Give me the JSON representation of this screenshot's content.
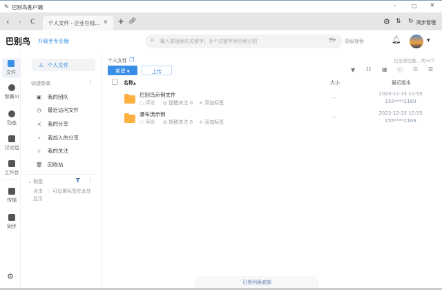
{
  "window": {
    "title": "巴别鸟客户端",
    "min": "–",
    "max": "□",
    "close": "×"
  },
  "tabbar": {
    "tab_title": "个人文件 - 企业在线...",
    "tab_close": "×",
    "new_tab": "+",
    "sync_label": "同步管理"
  },
  "header": {
    "logo": "巴别鸟",
    "upgrade": "升级至专业版",
    "search_placeholder": "输入要搜索的关键字，多个关键字用空格分割",
    "advanced_search": "高级搜索"
  },
  "rail": [
    {
      "label": "文件"
    },
    {
      "label": "智翼AI"
    },
    {
      "label": "动态"
    },
    {
      "label": "讨论组"
    },
    {
      "label": "工作台"
    },
    {
      "label": "传输"
    },
    {
      "label": "同步"
    }
  ],
  "sidebar": {
    "personal_files": "个人文件",
    "quick_menu": "快捷菜单",
    "items": [
      {
        "label": "我的团队"
      },
      {
        "label": "最近访问文件"
      },
      {
        "label": "我的分享"
      },
      {
        "label": "我加入的分享"
      },
      {
        "label": "我的关注"
      },
      {
        "label": "回收站"
      }
    ],
    "tags_title": "标签",
    "tags_hint_a": "点击",
    "tags_hint_b": "可设置标签在此处",
    "tags_hint_c": "显示"
  },
  "content": {
    "breadcrumb": "个人文件",
    "loaded_status": "已全部加载，共54个",
    "new_button": "新建",
    "upload_button": "上传",
    "col_name": "名称",
    "col_size": "大小",
    "col_version": "最近版本",
    "rows": [
      {
        "name": "巴别鸟示例文件",
        "comment": "评论",
        "remind": "提醒关注 0",
        "add_tag": "+ 添加标签",
        "size": "--",
        "date": "2023-12-15 10:55",
        "user": "155****2169"
      },
      {
        "name": "瀑布流示例",
        "comment": "评论",
        "remind": "提醒关注 0",
        "add_tag": "+ 添加标签",
        "size": "--",
        "date": "2023-12-15 10:55",
        "user": "155****2169"
      }
    ],
    "footer": "已到列表底部"
  },
  "colors": {
    "accent": "#3a8ee6",
    "folder": "#fbb040"
  }
}
